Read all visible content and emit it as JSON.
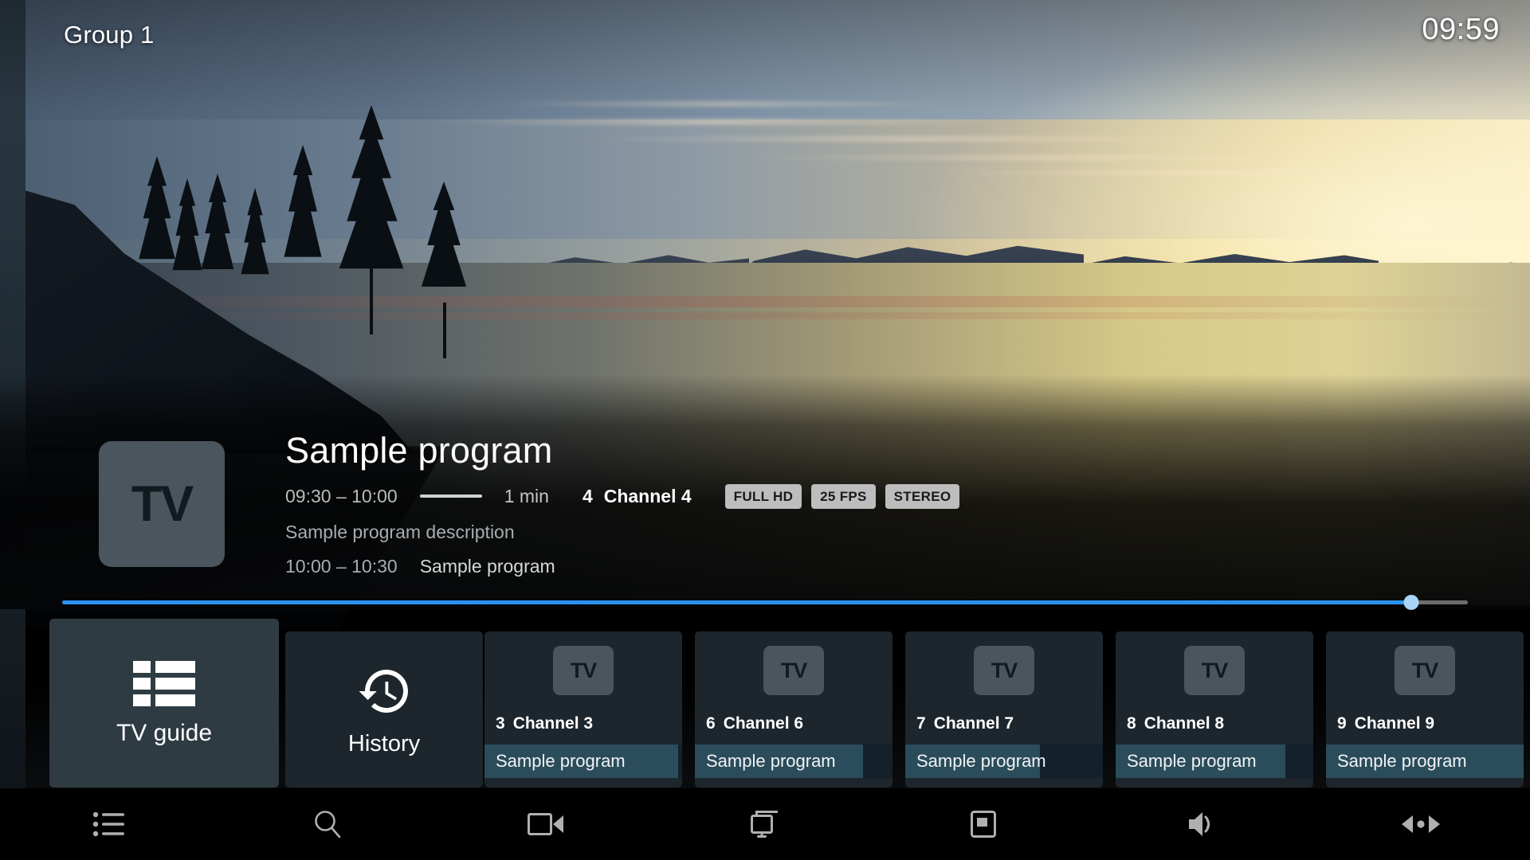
{
  "header": {
    "group_label": "Group 1",
    "clock": "09:59"
  },
  "program": {
    "logo_text": "TV",
    "title": "Sample program",
    "time_range": "09:30 – 10:00",
    "duration": "1 min",
    "channel_number": "4",
    "channel_name": "Channel 4",
    "badges": [
      "FULL HD",
      "25 FPS",
      "STEREO"
    ],
    "description": "Sample program description",
    "next_time_range": "10:00 – 10:30",
    "next_title": "Sample program"
  },
  "seek": {
    "progress_percent": 96,
    "fill_color": "#2a93ef",
    "thumb_color": "#a8d4f7",
    "track_color": "#6d6d6d"
  },
  "menu_tiles": [
    {
      "label": "TV guide",
      "icon": "list-grid-icon",
      "focused": true
    },
    {
      "label": "History",
      "icon": "history-clock-icon",
      "focused": false
    }
  ],
  "channel_tiles": [
    {
      "number": "3",
      "name": "Channel 3",
      "logo_text": "TV",
      "program": "Sample program",
      "progress_percent": 98
    },
    {
      "number": "6",
      "name": "Channel 6",
      "logo_text": "TV",
      "program": "Sample program",
      "progress_percent": 85
    },
    {
      "number": "7",
      "name": "Channel 7",
      "logo_text": "TV",
      "program": "Sample program",
      "progress_percent": 68
    },
    {
      "number": "8",
      "name": "Channel 8",
      "logo_text": "TV",
      "program": "Sample program",
      "progress_percent": 86
    },
    {
      "number": "9",
      "name": "Channel 9",
      "logo_text": "TV",
      "program": "Sample program",
      "progress_percent": 100
    }
  ],
  "toolbar": [
    {
      "icon": "list-icon",
      "name": "channel-list"
    },
    {
      "icon": "search-icon",
      "name": "search"
    },
    {
      "icon": "video-camera-icon",
      "name": "recordings"
    },
    {
      "icon": "cast-screen-icon",
      "name": "cast"
    },
    {
      "icon": "picture-in-picture-icon",
      "name": "pip"
    },
    {
      "icon": "volume-icon",
      "name": "volume"
    },
    {
      "icon": "audio-track-switch-icon",
      "name": "audio-track"
    }
  ],
  "theme": {
    "tile_bg": "#1d262c",
    "tile_focused_bg": "#2e3b43",
    "logo_bg": "#4a555d",
    "program_bar_bg": "#14202a",
    "program_bar_fill": "#2b4c5a",
    "badge_bg": "#bdbdbd",
    "toolbar_bg": "#000000",
    "accent": "#2a93ef"
  }
}
